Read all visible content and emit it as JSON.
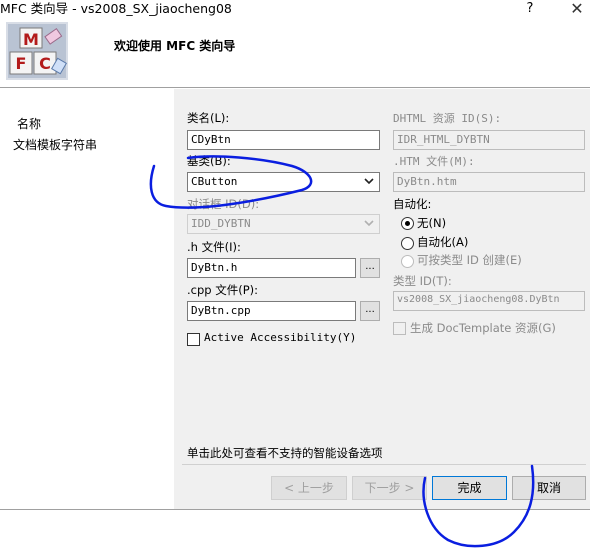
{
  "window": {
    "title": "MFC 类向导 - vs2008_SX_jiaocheng08",
    "help_glyph": "?",
    "close_glyph": "✕"
  },
  "banner": {
    "title": "欢迎使用 MFC 类向导",
    "logo_letters": [
      "M",
      "F",
      "C"
    ]
  },
  "nav": {
    "items": [
      {
        "label": "名称"
      },
      {
        "label": "文档模板字符串"
      }
    ]
  },
  "form": {
    "class_name": {
      "label": "类名(L):",
      "value": "CDyBtn"
    },
    "base_class": {
      "label": "基类(B):",
      "value": "CButton"
    },
    "dialog_id": {
      "label": "对话框 ID(D):",
      "value": "IDD_DYBTN"
    },
    "h_file": {
      "label": ".h 文件(I):",
      "value": "DyBtn.h",
      "browse": "..."
    },
    "cpp_file": {
      "label": ".cpp 文件(P):",
      "value": "DyBtn.cpp",
      "browse": "..."
    },
    "active_accessibility": {
      "label": "Active Accessibility(Y)"
    },
    "dhtml_id": {
      "label": "DHTML 资源 ID(S):",
      "value": "IDR_HTML_DYBTN"
    },
    "htm_file": {
      "label": ".HTM 文件(M):",
      "value": "DyBtn.htm"
    },
    "automation": {
      "label": "自动化:",
      "options": [
        {
          "label": "无(N)",
          "checked": true
        },
        {
          "label": "自动化(A)",
          "checked": false
        },
        {
          "label": "可按类型 ID 创建(E)",
          "checked": false
        }
      ]
    },
    "type_id": {
      "label": "类型 ID(T):",
      "value": "vs2008_SX_jiaocheng08.DyBtn"
    },
    "doctemplate": {
      "label": "生成 DocTemplate 资源(G)"
    }
  },
  "hint": {
    "text": "单击此处可查看不支持的智能设备选项"
  },
  "buttons": {
    "prev": "< 上一步",
    "next": "下一步 >",
    "finish": "完成",
    "cancel": "取消"
  },
  "annotation": {
    "color": "#0a1ee0"
  }
}
